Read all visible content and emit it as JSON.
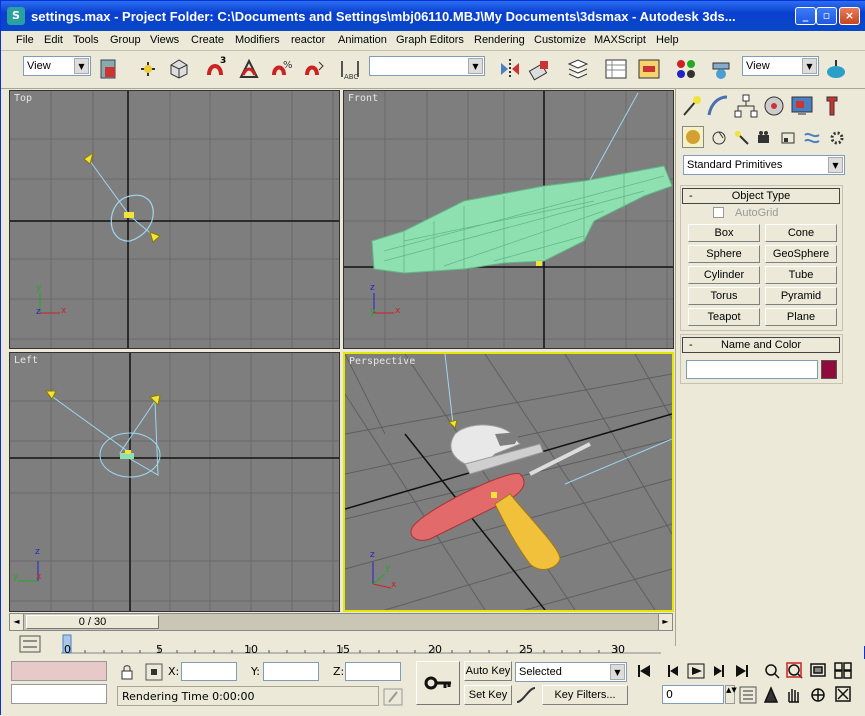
{
  "window": {
    "title": "settings.max   - Project Folder: C:\\Documents and Settings\\mbj06110.MBJ\\My Documents\\3dsmax    - Autodesk 3ds...",
    "app_icon": "3dsmax-icon",
    "controls": [
      "minimize",
      "restore",
      "close"
    ]
  },
  "menu": [
    "File",
    "Edit",
    "Tools",
    "Group",
    "Views",
    "Create",
    "Modifiers",
    "reactor",
    "Animation",
    "Graph Editors",
    "Rendering",
    "Customize",
    "MAXScript",
    "Help"
  ],
  "toolbar": {
    "view_combo_1": "View",
    "selection_set_combo": "",
    "view_combo_2": "View",
    "snap_label": "3"
  },
  "viewports": {
    "top": "Top",
    "front": "Front",
    "left": "Left",
    "perspective": "Perspective"
  },
  "axis": {
    "x": "x",
    "y": "y",
    "z": "z"
  },
  "command_panel": {
    "category": "Standard Primitives",
    "object_type": {
      "header": "Object Type",
      "autogrid": "AutoGrid",
      "buttons": [
        "Box",
        "Cone",
        "Sphere",
        "GeoSphere",
        "Cylinder",
        "Tube",
        "Torus",
        "Pyramid",
        "Teapot",
        "Plane"
      ]
    },
    "name_color": {
      "header": "Name and Color",
      "name_value": "",
      "swatch_color": "#8e0b3c"
    }
  },
  "timeslider": {
    "label": "0 / 30"
  },
  "trackbar": {
    "ticks": [
      "0",
      "5",
      "10",
      "15",
      "20",
      "25",
      "30"
    ]
  },
  "status": {
    "x_label": "X:",
    "y_label": "Y:",
    "z_label": "Z:",
    "x_value": "",
    "y_value": "",
    "z_value": "",
    "auto_key": "Auto Key",
    "set_key": "Set Key",
    "selected": "Selected",
    "key_filters": "Key Filters...",
    "frame": "0",
    "rendering_time": "Rendering Time  0:00:00"
  },
  "colors": {
    "title_blue": "#0a3fd0",
    "viewport_bg": "#7e7e7e",
    "active_border": "#e6e600",
    "wire_green": "#8fe0b0",
    "light_blue": "#9fd6f0",
    "yellow_light": "#f2e33b"
  }
}
